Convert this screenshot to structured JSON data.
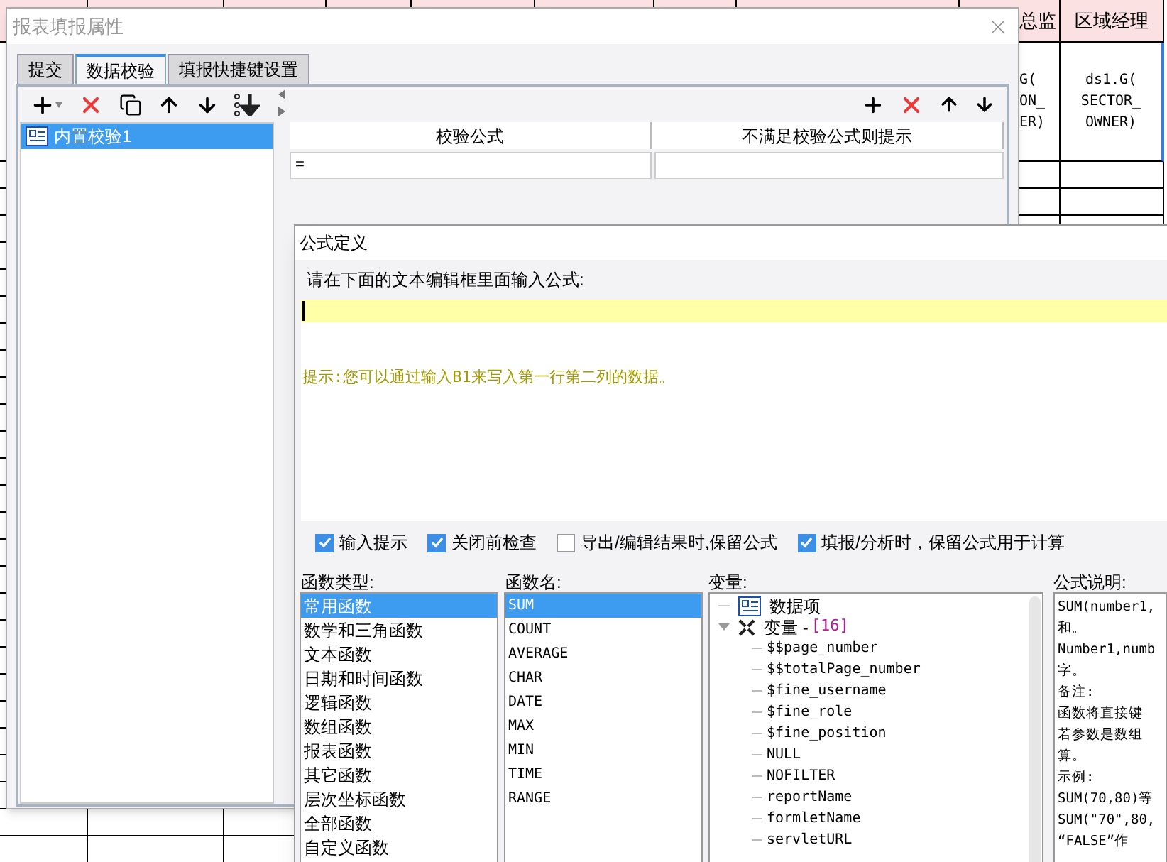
{
  "sheet": {
    "header": [
      "总监",
      "区域经理"
    ],
    "cells": [
      {
        "lines": [
          "G(",
          "ON_",
          "ER)"
        ]
      },
      {
        "lines": [
          "ds1.G(",
          "SECTOR_",
          "OWNER)"
        ],
        "selected": true
      }
    ]
  },
  "report_dialog": {
    "title": "报表填报属性",
    "tabs": [
      {
        "label": "提交",
        "selected": false
      },
      {
        "label": "数据校验",
        "selected": true
      },
      {
        "label": "填报快捷键设置",
        "selected": false
      }
    ],
    "rules": [
      {
        "label": "内置校验1",
        "selected": true
      }
    ],
    "table": {
      "columns": [
        "校验公式",
        "不满足校验公式则提示"
      ],
      "rows": [
        [
          "=",
          ""
        ]
      ]
    }
  },
  "formula_dialog": {
    "title": "公式定义",
    "prompt": "请在下面的文本编辑框里面输入公式:",
    "hint": "提示:您可以通过输入B1来写入第一行第二列的数据。",
    "options": [
      {
        "label": "输入提示",
        "checked": true
      },
      {
        "label": "关闭前检查",
        "checked": true
      },
      {
        "label": "导出/编辑结果时,保留公式",
        "checked": false
      },
      {
        "label": "填报/分析时，保留公式用于计算",
        "checked": true
      }
    ],
    "function_types": {
      "label": "函数类型:",
      "items": [
        {
          "label": "常用函数",
          "selected": true
        },
        {
          "label": "数学和三角函数",
          "selected": false
        },
        {
          "label": "文本函数",
          "selected": false
        },
        {
          "label": "日期和时间函数",
          "selected": false
        },
        {
          "label": "逻辑函数",
          "selected": false
        },
        {
          "label": "数组函数",
          "selected": false
        },
        {
          "label": "报表函数",
          "selected": false
        },
        {
          "label": "其它函数",
          "selected": false
        },
        {
          "label": "层次坐标函数",
          "selected": false
        },
        {
          "label": "全部函数",
          "selected": false
        },
        {
          "label": "自定义函数",
          "selected": false
        }
      ]
    },
    "function_names": {
      "label": "函数名:",
      "items": [
        {
          "label": "SUM",
          "selected": true
        },
        {
          "label": "COUNT",
          "selected": false
        },
        {
          "label": "AVERAGE",
          "selected": false
        },
        {
          "label": "CHAR",
          "selected": false
        },
        {
          "label": "DATE",
          "selected": false
        },
        {
          "label": "MAX",
          "selected": false
        },
        {
          "label": "MIN",
          "selected": false
        },
        {
          "label": "TIME",
          "selected": false
        },
        {
          "label": "RANGE",
          "selected": false
        }
      ]
    },
    "variables": {
      "label": "变量:",
      "items": [
        {
          "label": "数据项",
          "kind": "data"
        },
        {
          "label": "变量 -",
          "count": "[16]",
          "kind": "group",
          "expanded": true,
          "children": [
            {
              "label": "$$page_number"
            },
            {
              "label": "$$totalPage_number"
            },
            {
              "label": "$fine_username"
            },
            {
              "label": "$fine_role"
            },
            {
              "label": "$fine_position"
            },
            {
              "label": "NULL"
            },
            {
              "label": "NOFILTER"
            },
            {
              "label": "reportName"
            },
            {
              "label": "formletName"
            },
            {
              "label": "servletURL"
            }
          ]
        }
      ]
    },
    "description": {
      "label": "公式说明:",
      "lines": [
        "SUM(number1,",
        "和。",
        "Number1,numb",
        "字。",
        "备注:",
        "函数将直接键",
        "若参数是数组",
        "算。",
        "示例:",
        "SUM(70,80)等",
        "SUM(\"70\",80,",
        "“FALSE”作"
      ]
    }
  }
}
